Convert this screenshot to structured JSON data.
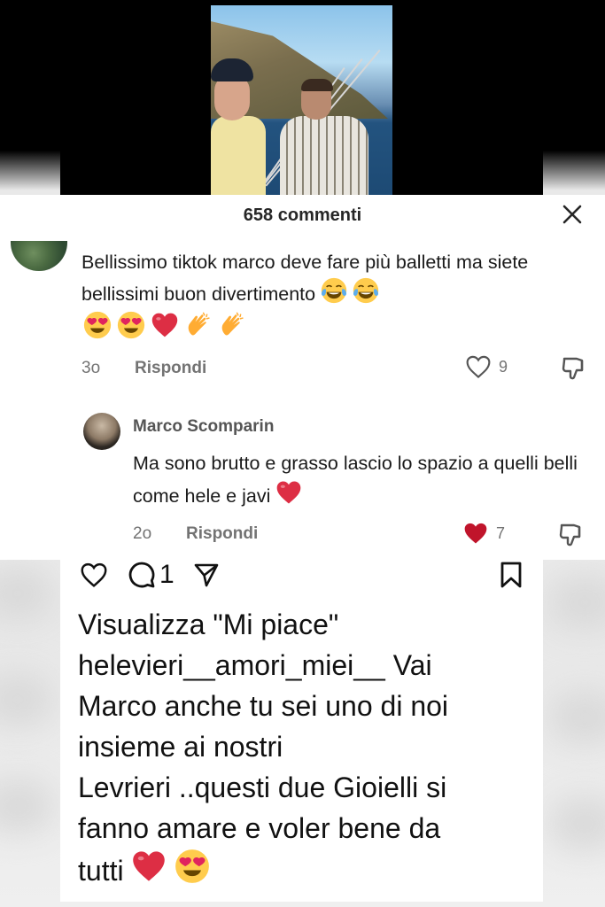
{
  "panel": {
    "title": "658 commenti",
    "close_icon": "close-icon"
  },
  "comments": [
    {
      "text": "Bellissimo tiktok marco deve fare più balletti ma siete bellissimi buon divertimento",
      "inline_emojis": [
        "tears-of-joy",
        "tears-of-joy"
      ],
      "emojis": [
        "heart-eyes",
        "heart-eyes",
        "red-heart",
        "clapping-hands",
        "clapping-hands"
      ],
      "time": "3o",
      "reply_label": "Rispondi",
      "likes": "9",
      "liked": false
    }
  ],
  "reply": {
    "author": "Marco Scomparin",
    "text": "Ma sono brutto e grasso lascio lo spazio a quelli belli come hele e javi",
    "emoji": "red-heart",
    "time": "2o",
    "reply_label": "Rispondi",
    "likes": "7",
    "liked": true
  },
  "post": {
    "comment_count": "1",
    "view_likes": "Visualizza \"Mi piace\"",
    "caption_lines": [
      "helevieri__amori_miei__ Vai",
      "Marco anche tu sei uno di noi",
      "insieme ai nostri",
      "Levrieri ..questi due Gioielli si",
      "fanno amare e voler bene da",
      "tutti"
    ],
    "caption_emojis": [
      "red-heart",
      "heart-eyes"
    ]
  },
  "colors": {
    "liked_heart": "#c0142b",
    "muted_text": "#737373",
    "text": "#1a1a1a"
  }
}
